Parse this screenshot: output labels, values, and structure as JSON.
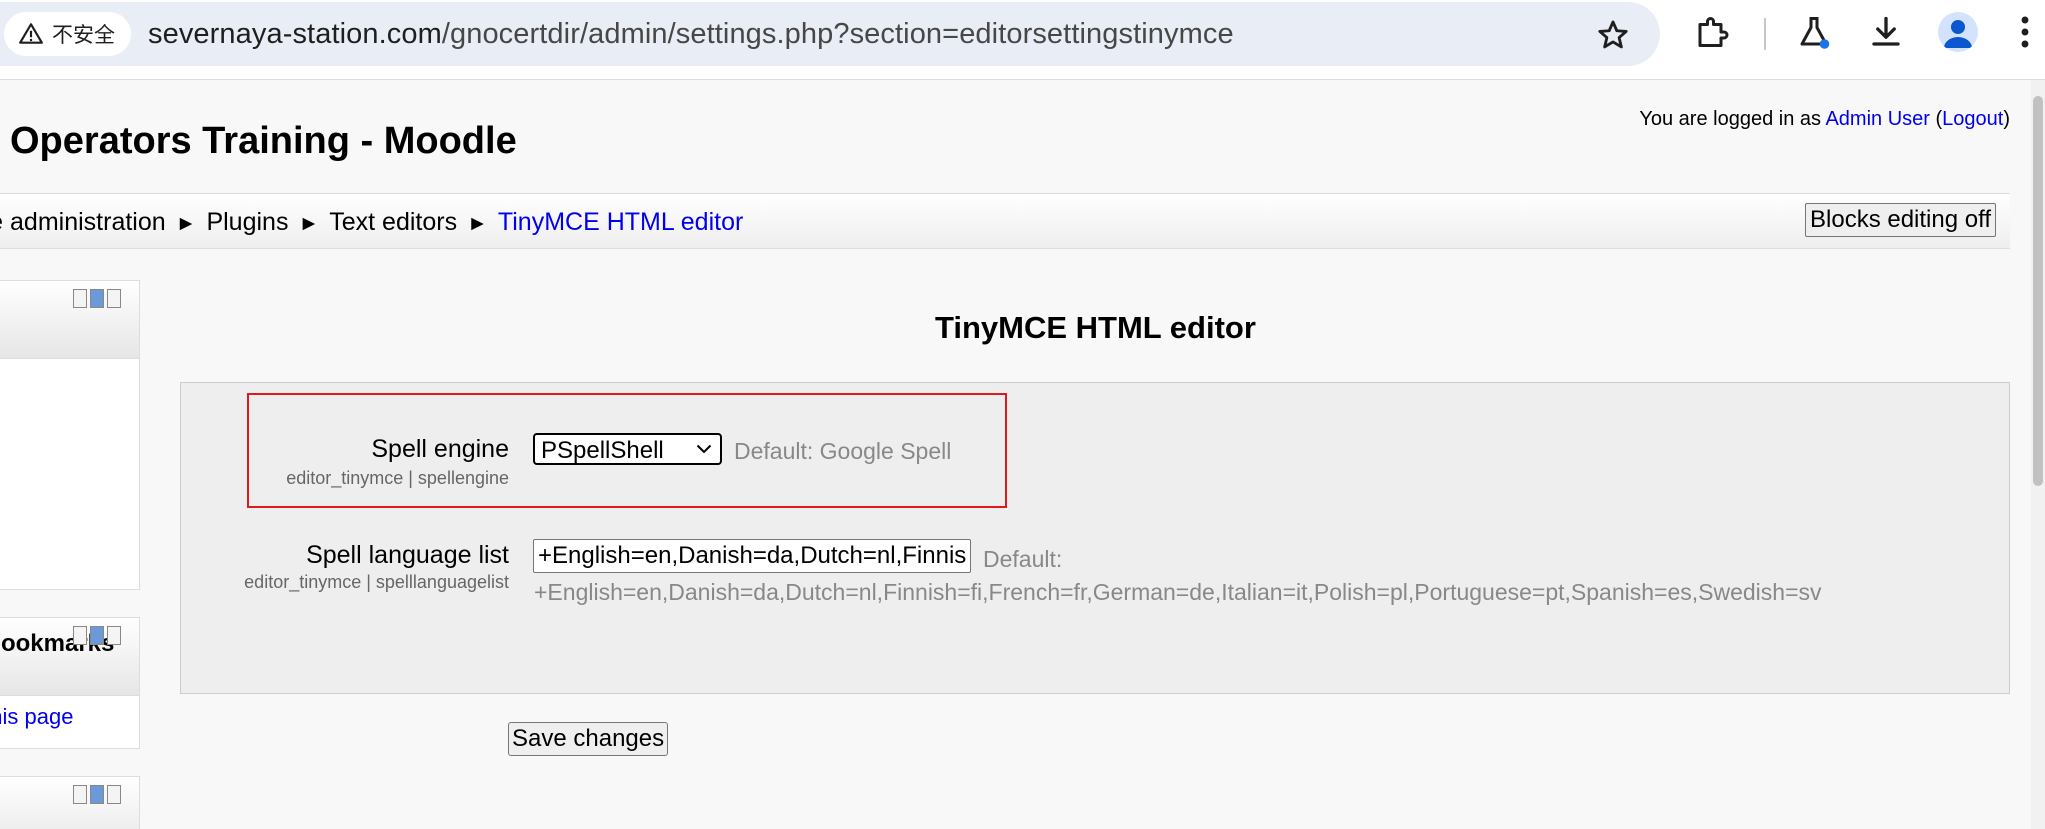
{
  "browser": {
    "security_label": "不安全",
    "url_host": "severnaya-station.com",
    "url_path": "/gnocertdir/admin/settings.php?section=editorsettingstinymce"
  },
  "header": {
    "site_title": "Operators Training - Moodle",
    "login_prefix": "You are logged in as ",
    "user_name": "Admin User",
    "paren_open": " (",
    "logout_label": "Logout",
    "paren_close": ")"
  },
  "breadcrumb": {
    "items": [
      "Site administration",
      "Plugins",
      "Text editors"
    ],
    "separator": "►",
    "current": "TinyMCE HTML editor"
  },
  "editing_button": "Blocks editing off",
  "blocks": {
    "second_title": "Admin bookmarks",
    "second_link": "Bookmark this page"
  },
  "main": {
    "heading": "TinyMCE HTML editor",
    "settings": [
      {
        "label": "Spell engine",
        "sub": "editor_tinymce | spellengine",
        "value": "PSpellShell",
        "default": "Default: Google Spell"
      },
      {
        "label": "Spell language list",
        "sub": "editor_tinymce | spelllanguagelist",
        "value": "+English=en,Danish=da,Dutch=nl,Finnish=fi,French=fr,German=de,Italian=it,Polish=pl,Portuguese=pt,Spanish=es,Swedish=sv",
        "default_label": "Default:",
        "default_value": "+English=en,Danish=da,Dutch=nl,Finnish=fi,French=fr,German=de,Italian=it,Polish=pl,Portuguese=pt,Spanish=es,Swedish=sv"
      }
    ],
    "save_label": "Save changes"
  },
  "colors": {
    "highlight": "#e0191f",
    "link": "#0000ee",
    "omnibox": "#e9eef6"
  }
}
